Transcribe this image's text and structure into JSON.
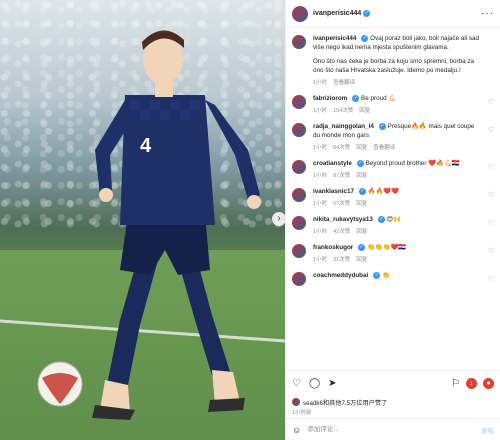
{
  "post": {
    "author": "ivanperisic444",
    "caption_author": "ivanperisic444",
    "caption_p1": "Ovaj poraz boli jako, boli najače ali sad više nego ikad nema mjesta spuštenim glavama.",
    "caption_p2": "Ono što nas čeka je borba za koju smo spremni, borba za ono što naša Hrvatska zaslužuje. Idemo po medalju.!",
    "caption_time": "1小时",
    "caption_translate": "查看翻译",
    "likes_text": "seadk6和其他7.5万位用户赞了",
    "post_time": "1小时前",
    "comment_placeholder": "添加评论…",
    "post_label": "发布"
  },
  "comments": [
    {
      "user": "fabriziorom",
      "text": "Be proud 💪🏻",
      "time": "1小时",
      "likes": "154次赞",
      "reply": "回复"
    },
    {
      "user": "radja_nainggolan_l4",
      "text": "Presque🔥🔥 mais quel coupe du monde mon gars",
      "time": "1小时",
      "likes": "64次赞",
      "reply": "回复",
      "translate": "查看翻译"
    },
    {
      "user": "croatianstyle",
      "text": "Beyond proud brother ❤️🔥💪🏻🇭🇷",
      "time": "1小时",
      "likes": "87次赞",
      "reply": "回复"
    },
    {
      "user": "ivanklasnic17",
      "text": "🔥🔥❤️❤️",
      "time": "1小时",
      "likes": "57次赞",
      "reply": "回复"
    },
    {
      "user": "nikita_rukavytsya13",
      "text": "😍🙌",
      "time": "1小时",
      "likes": "42次赞",
      "reply": "回复"
    },
    {
      "user": "frankoskugor",
      "text": "👏👏👏❤️🇭🇷",
      "time": "1小时",
      "likes": "31次赞",
      "reply": "回复"
    },
    {
      "user": "coachmeddydubai",
      "text": "👏",
      "time": "",
      "likes": "",
      "reply": ""
    }
  ],
  "icons": {
    "more": "more-horizontal-icon",
    "heart": "heart-icon",
    "comment": "comment-icon",
    "share": "share-icon",
    "save": "bookmark-icon",
    "emoji": "emoji-icon",
    "next": "chevron-right-icon"
  },
  "colors": {
    "accent": "#3897f0",
    "red": "#e0412f",
    "jersey": "#1b2a5a"
  }
}
